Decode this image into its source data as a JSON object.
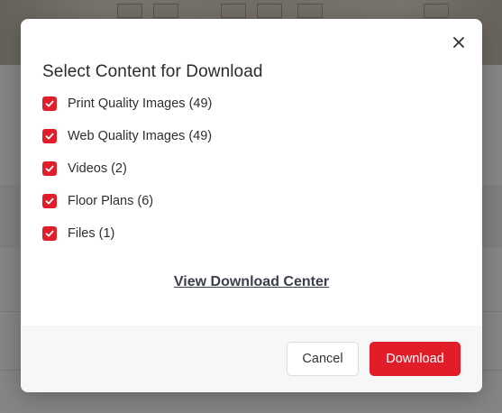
{
  "colors": {
    "accent": "#e11d2a",
    "title_text": "#2b2b2b",
    "link_text": "#3a3f4a"
  },
  "modal": {
    "title": "Select Content for Download",
    "close_icon": "close-icon",
    "options": [
      {
        "label": "Print Quality Images (49)",
        "checked": true
      },
      {
        "label": "Web Quality Images (49)",
        "checked": true
      },
      {
        "label": "Videos (2)",
        "checked": true
      },
      {
        "label": "Floor Plans (6)",
        "checked": true
      },
      {
        "label": "Files (1)",
        "checked": true
      }
    ],
    "link_label": "View Download Center",
    "cancel_label": "Cancel",
    "download_label": "Download"
  }
}
